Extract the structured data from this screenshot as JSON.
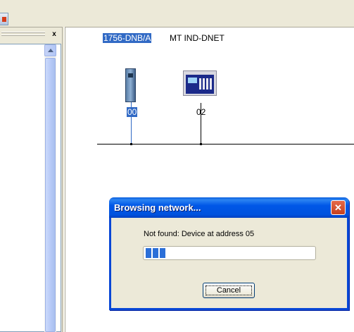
{
  "canvas": {
    "scanner_label": "1756-DNB/A",
    "device_label": "MT IND-DNET",
    "scanner_address": "00",
    "device_address": "02"
  },
  "dialog": {
    "title": "Browsing network...",
    "close_glyph": "✕",
    "message": "Not found: Device at address 05",
    "progress": 0.12,
    "cancel_label": "Cancel"
  },
  "left_pane": {
    "close_glyph": "x"
  },
  "icons": [
    "toolbar-icon",
    "close-icon",
    "scroll-up-arrow-icon",
    "controllogix-module-icon",
    "terminal-device-icon"
  ],
  "colors": {
    "selection": "#316ac5",
    "dialog_title": "#0055e5",
    "window_face": "#ece9d8"
  }
}
